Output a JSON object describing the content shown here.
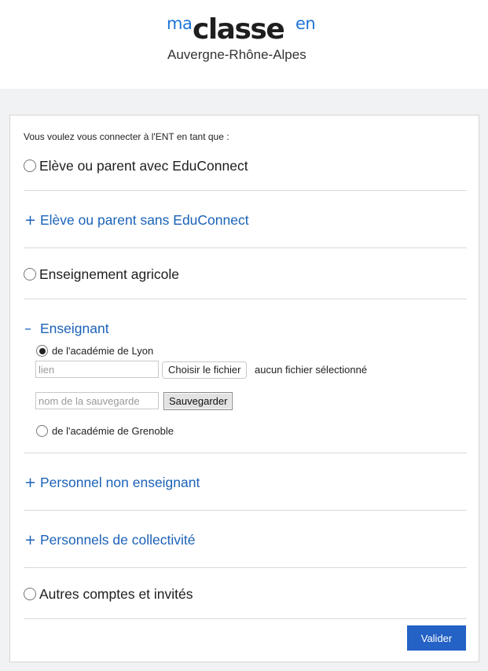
{
  "logo": {
    "ma": "ma",
    "classe": "classe",
    "en": "en",
    "region": "Auvergne-Rhône-Alpes"
  },
  "colors": {
    "accent": "#1b62b8",
    "button": "#2462c5",
    "background": "#f1f2f4"
  },
  "form": {
    "intro": "Vous voulez vous connecter à l'ENT en tant que :",
    "options": [
      {
        "type": "radio",
        "label": "Elève ou parent avec EduConnect",
        "checked": false
      },
      {
        "type": "accordion",
        "sign": "+",
        "label": "Elève ou parent sans EduConnect",
        "expanded": false
      },
      {
        "type": "radio",
        "label": "Enseignement agricole",
        "checked": false
      },
      {
        "type": "accordion",
        "sign": "–",
        "label": "Enseignant",
        "expanded": true
      },
      {
        "type": "accordion",
        "sign": "+",
        "label": "Personnel non enseignant",
        "expanded": false
      },
      {
        "type": "accordion",
        "sign": "+",
        "label": "Personnels de collectivité",
        "expanded": false
      },
      {
        "type": "radio",
        "label": "Autres comptes et invités",
        "checked": false
      }
    ],
    "enseignant": {
      "lyon_label": "de l'académie de Lyon",
      "lyon_checked": true,
      "link_placeholder": "lien",
      "file_button": "Choisir le fichier",
      "file_status": "aucun fichier sélectionné",
      "save_placeholder": "nom de la sauvegarde",
      "save_button": "Sauvegarder",
      "grenoble_label": "de l'académie de Grenoble",
      "grenoble_checked": false
    },
    "submit": "Valider"
  }
}
